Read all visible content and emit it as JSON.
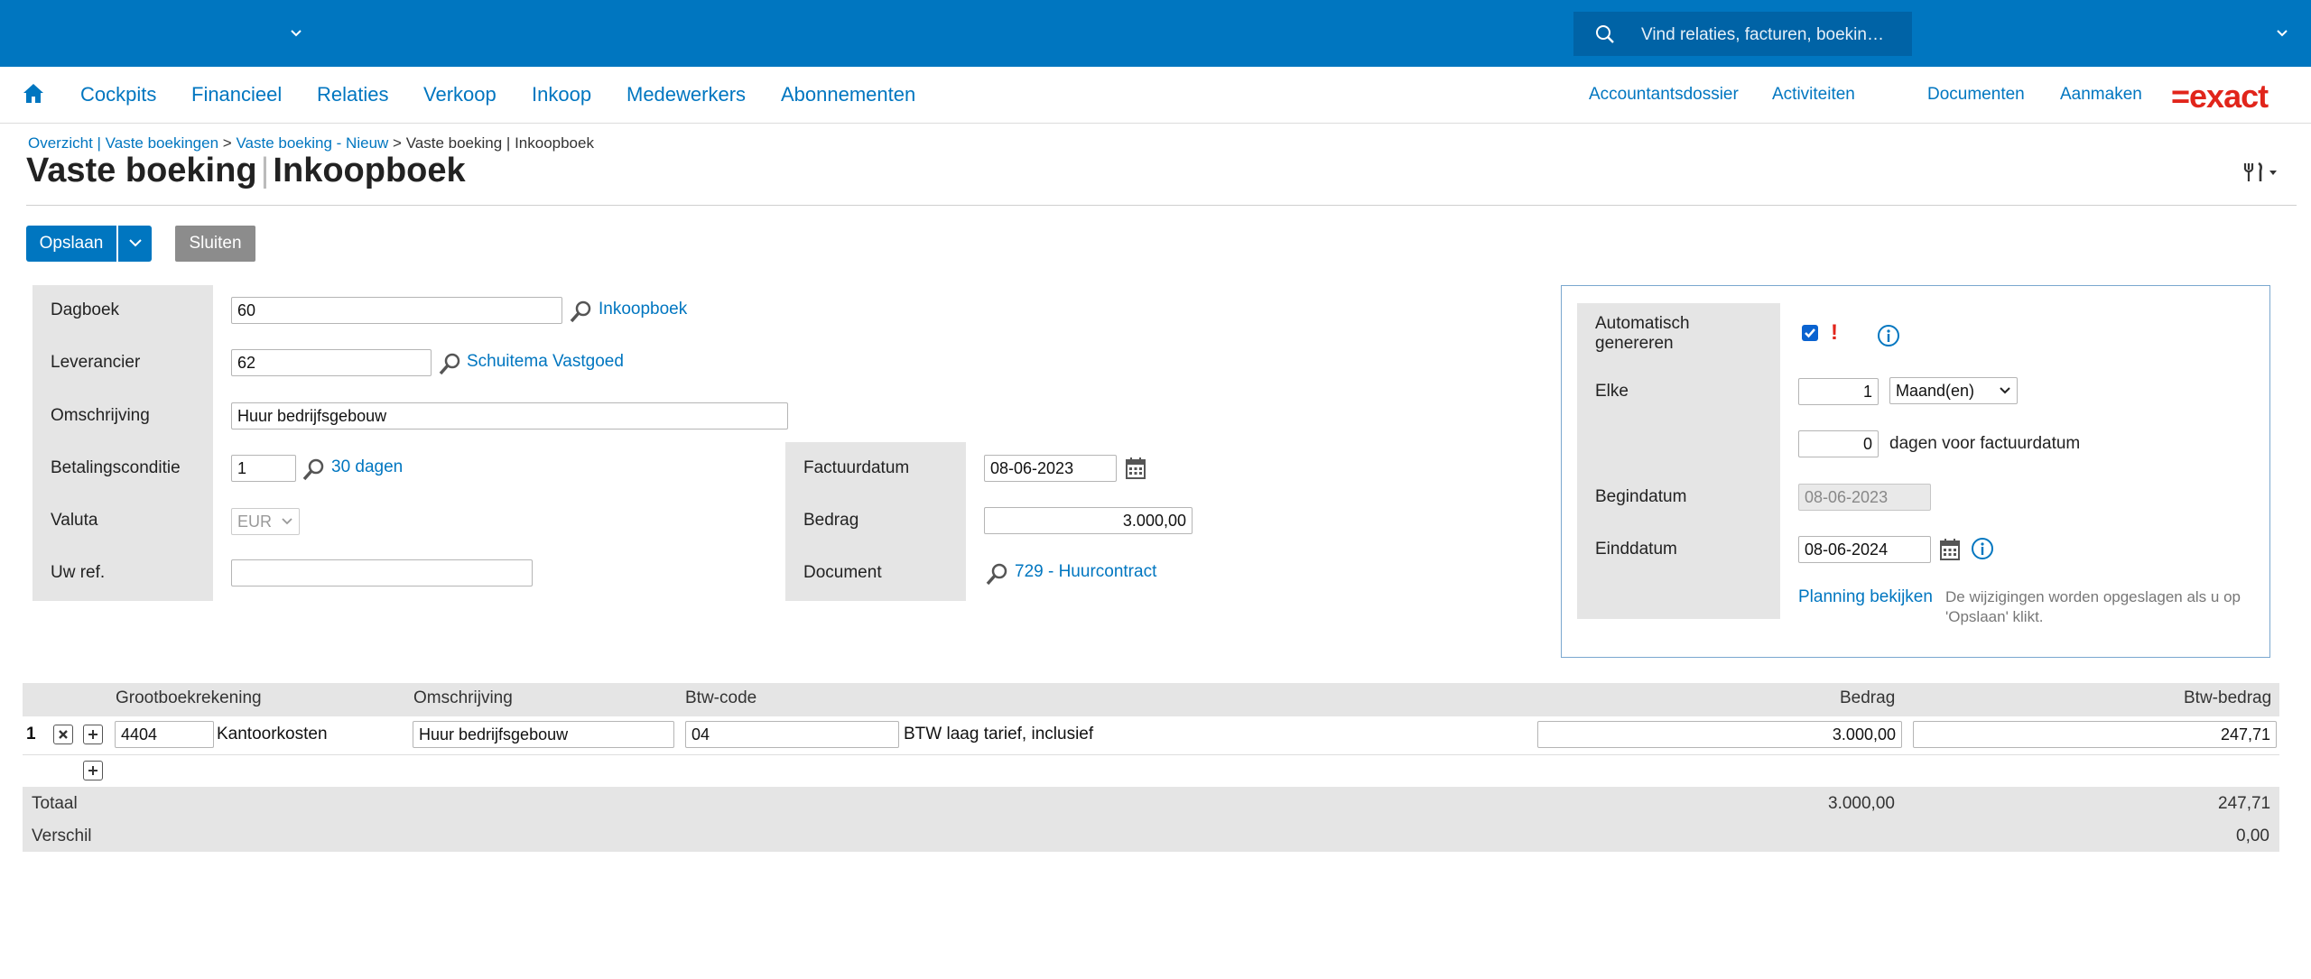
{
  "topbar": {
    "search_placeholder": "Vind relaties, facturen, boekin…"
  },
  "nav": {
    "main": [
      "Cockpits",
      "Financieel",
      "Relaties",
      "Verkoop",
      "Inkoop",
      "Medewerkers",
      "Abonnementen"
    ],
    "right": [
      "Accountantsdossier",
      "Activiteiten",
      "Documenten",
      "Aanmaken"
    ],
    "logo": "=exact"
  },
  "breadcrumb": {
    "item1": "Overzicht | Vaste boekingen",
    "sep1": ">",
    "item2": "Vaste boeking - Nieuw",
    "sep2": ">",
    "current": "Vaste boeking | Inkoopboek"
  },
  "page_title": {
    "part1": "Vaste boeking",
    "separator": "|",
    "part2": "Inkoopboek"
  },
  "toolbar": {
    "save": "Opslaan",
    "close": "Sluiten"
  },
  "form": {
    "dagboek": {
      "label": "Dagboek",
      "value": "60",
      "link": "Inkoopboek"
    },
    "leverancier": {
      "label": "Leverancier",
      "value": "62",
      "link": "Schuitema Vastgoed"
    },
    "omschrijving": {
      "label": "Omschrijving",
      "value": "Huur bedrijfsgebouw"
    },
    "betalingsconditie": {
      "label": "Betalingsconditie",
      "value": "1",
      "link": "30 dagen"
    },
    "valuta": {
      "label": "Valuta",
      "value": "EUR"
    },
    "uwref": {
      "label": "Uw ref.",
      "value": ""
    },
    "factuurdatum": {
      "label": "Factuurdatum",
      "value": "08-06-2023"
    },
    "bedrag": {
      "label": "Bedrag",
      "value": "3.000,00"
    },
    "document": {
      "label": "Document",
      "link": "729 - Huurcontract"
    }
  },
  "panel": {
    "auto_label_1": "Automatisch",
    "auto_label_2": "genereren",
    "auto_checked": true,
    "warning": "!",
    "elke_label": "Elke",
    "elke_value": "1",
    "period_select": "Maand(en)",
    "days_value": "0",
    "days_text": "dagen voor factuurdatum",
    "begindatum_label": "Begindatum",
    "begindatum_value": "08-06-2023",
    "einddatum_label": "Einddatum",
    "einddatum_value": "08-06-2024",
    "planning_link": "Planning bekijken",
    "hint_1": "De wijzigingen worden opgeslagen als u op",
    "hint_2": "'Opslaan' klikt."
  },
  "table": {
    "headers": {
      "grootboek": "Grootboekrekening",
      "omschrijving": "Omschrijving",
      "btwcode": "Btw-code",
      "bedrag": "Bedrag",
      "btwbedrag": "Btw-bedrag"
    },
    "rows": [
      {
        "num": "1",
        "account": "4404",
        "account_name": "Kantoorkosten",
        "description": "Huur bedrijfsgebouw",
        "vat_code": "04",
        "vat_desc": "BTW laag tarief, inclusief",
        "amount": "3.000,00",
        "vat_amount": "247,71"
      }
    ],
    "total_label": "Totaal",
    "total_amount": "3.000,00",
    "total_vat": "247,71",
    "diff_label": "Verschil",
    "diff_value": "0,00"
  }
}
